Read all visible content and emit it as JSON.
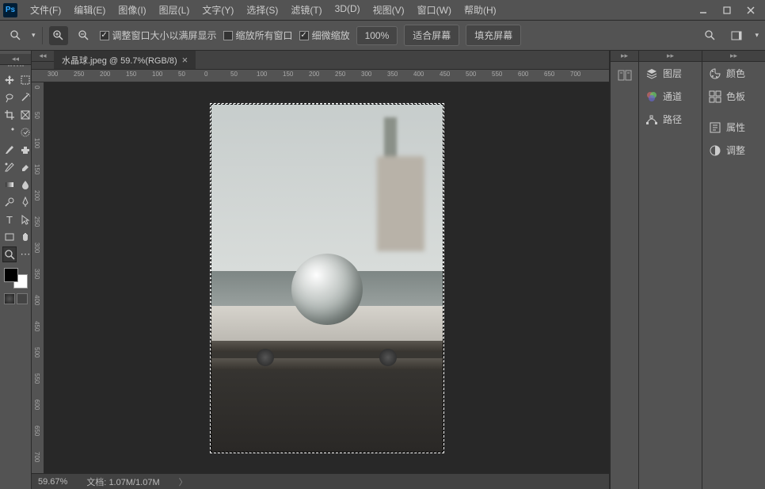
{
  "app": {
    "logo": "Ps"
  },
  "menus": [
    "文件(F)",
    "编辑(E)",
    "图像(I)",
    "图层(L)",
    "文字(Y)",
    "选择(S)",
    "滤镜(T)",
    "3D(D)",
    "视图(V)",
    "窗口(W)",
    "帮助(H)"
  ],
  "options": {
    "chk1": "调整窗口大小以满屏显示",
    "chk2": "缩放所有窗口",
    "chk3": "细微缩放",
    "btn100": "100%",
    "btnFit": "适合屏幕",
    "btnFill": "填充屏幕"
  },
  "tab": {
    "title": "水晶球.jpeg @ 59.7%(RGB/8)"
  },
  "ruler_h": [
    "300",
    "250",
    "200",
    "150",
    "100",
    "50",
    "0",
    "50",
    "100",
    "150",
    "200",
    "250",
    "300",
    "350",
    "400",
    "450",
    "500",
    "550",
    "600",
    "650",
    "700"
  ],
  "ruler_v": [
    "0",
    "50",
    "100",
    "150",
    "200",
    "250",
    "300",
    "350",
    "400",
    "450",
    "500",
    "550",
    "600",
    "650",
    "700"
  ],
  "status": {
    "zoom": "59.67%",
    "docLabel": "文档:",
    "docInfo": "1.07M/1.07M"
  },
  "panels_mid": [
    "图层",
    "通道",
    "路径"
  ],
  "panels_right": [
    "颜色",
    "色板",
    "属性",
    "调整"
  ]
}
